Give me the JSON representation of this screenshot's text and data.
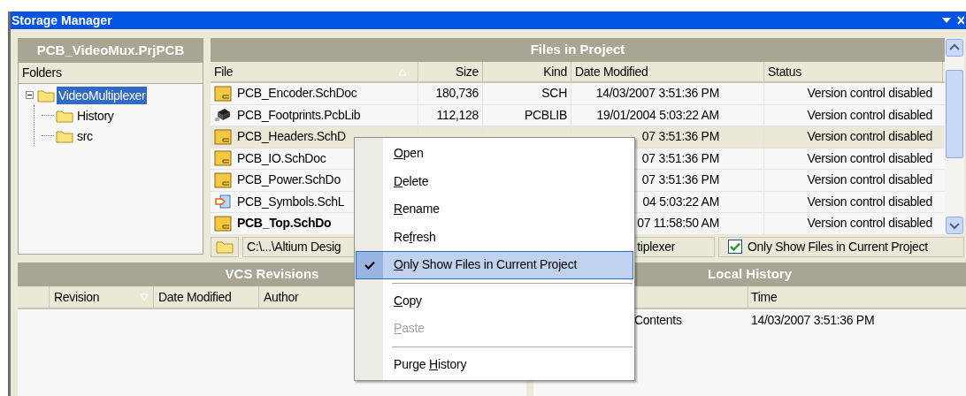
{
  "window": {
    "title": "Storage Manager"
  },
  "project_panel": {
    "title": "PCB_VideoMux.PrjPCB",
    "column": "Folders",
    "tree": [
      {
        "label": "VideoMultiplexer",
        "selected": true,
        "expanded": true,
        "children": [
          {
            "label": "History",
            "selected": false
          },
          {
            "label": "src",
            "selected": false
          }
        ]
      }
    ]
  },
  "files_panel": {
    "title": "Files in Project",
    "columns": [
      {
        "label": "File",
        "sorted_ascending": true
      },
      {
        "label": "Size"
      },
      {
        "label": "Kind"
      },
      {
        "label": "Date Modified"
      },
      {
        "label": "Status"
      }
    ],
    "rows": [
      {
        "kind": "sch",
        "file": "PCB_Encoder.SchDoc",
        "size": "180,736",
        "kind_label": "SCH",
        "date": "14/03/2007 3:51:36 PM",
        "status": "Version control disabled",
        "selected": false,
        "bold": false
      },
      {
        "kind": "pcblib",
        "file": "PCB_Footprints.PcbLib",
        "size": "112,128",
        "kind_label": "PCBLIB",
        "date": "19/01/2004 5:03:22 AM",
        "status": "Version control disabled",
        "selected": false,
        "bold": false
      },
      {
        "kind": "sch",
        "file": "PCB_Headers.SchD",
        "date": "07 3:51:36 PM",
        "status": "Version control disabled",
        "selected": true,
        "bold": false
      },
      {
        "kind": "sch",
        "file": "PCB_IO.SchDoc",
        "date": "07 3:51:36 PM",
        "status": "Version control disabled",
        "selected": false,
        "bold": false
      },
      {
        "kind": "sch",
        "file": "PCB_Power.SchDo",
        "date": "07 3:51:36 PM",
        "status": "Version control disabled",
        "selected": false,
        "bold": false
      },
      {
        "kind": "schlib",
        "file": "PCB_Symbols.SchL",
        "date": "04 5:03:22 AM",
        "status": "Version control disabled",
        "selected": false,
        "bold": false
      },
      {
        "kind": "sch",
        "file": "PCB_Top.SchDo",
        "date": "07 11:58:50 AM",
        "status": "Version control disabled",
        "selected": false,
        "bold": true
      }
    ],
    "path_parts": [
      "C:\\...\\Altium Desig",
      "tiplexer"
    ],
    "only_current": {
      "label": "Only Show Files in Current Project",
      "checked": true
    }
  },
  "vcs_panel": {
    "title": "VCS Revisions",
    "columns": [
      {
        "label": "Revision",
        "sorted_descending": true
      },
      {
        "label": "Date Modified"
      },
      {
        "label": "Author"
      }
    ]
  },
  "local_history": {
    "title": "Local History",
    "columns": [
      {
        "label": "Time"
      }
    ],
    "rows": [
      {
        "description": "Contents",
        "time": "14/03/2007 3:51:36 PM"
      }
    ]
  },
  "context_menu": [
    {
      "kind": "item",
      "key": "O",
      "after": "pen",
      "checked": false,
      "selected": false,
      "disabled": false
    },
    {
      "kind": "item",
      "key": "D",
      "after": "elete",
      "checked": false,
      "selected": false,
      "disabled": false
    },
    {
      "kind": "item",
      "key": "R",
      "after": "ename",
      "checked": false,
      "selected": false,
      "disabled": false
    },
    {
      "kind": "item",
      "before": "Re",
      "key": "f",
      "after": "resh",
      "checked": false,
      "selected": false,
      "disabled": false
    },
    {
      "kind": "item",
      "key": "O",
      "after": "nly Show Files in Current Project",
      "checked": true,
      "selected": true,
      "disabled": false
    },
    {
      "kind": "separator"
    },
    {
      "kind": "item",
      "key": "C",
      "after": "opy",
      "checked": false,
      "selected": false,
      "disabled": false
    },
    {
      "kind": "item",
      "key": "P",
      "after": "aste",
      "checked": false,
      "selected": false,
      "disabled": true
    },
    {
      "kind": "separator"
    },
    {
      "kind": "item",
      "before": "Purge ",
      "key": "H",
      "after": "istory",
      "checked": false,
      "selected": false,
      "disabled": false
    }
  ]
}
